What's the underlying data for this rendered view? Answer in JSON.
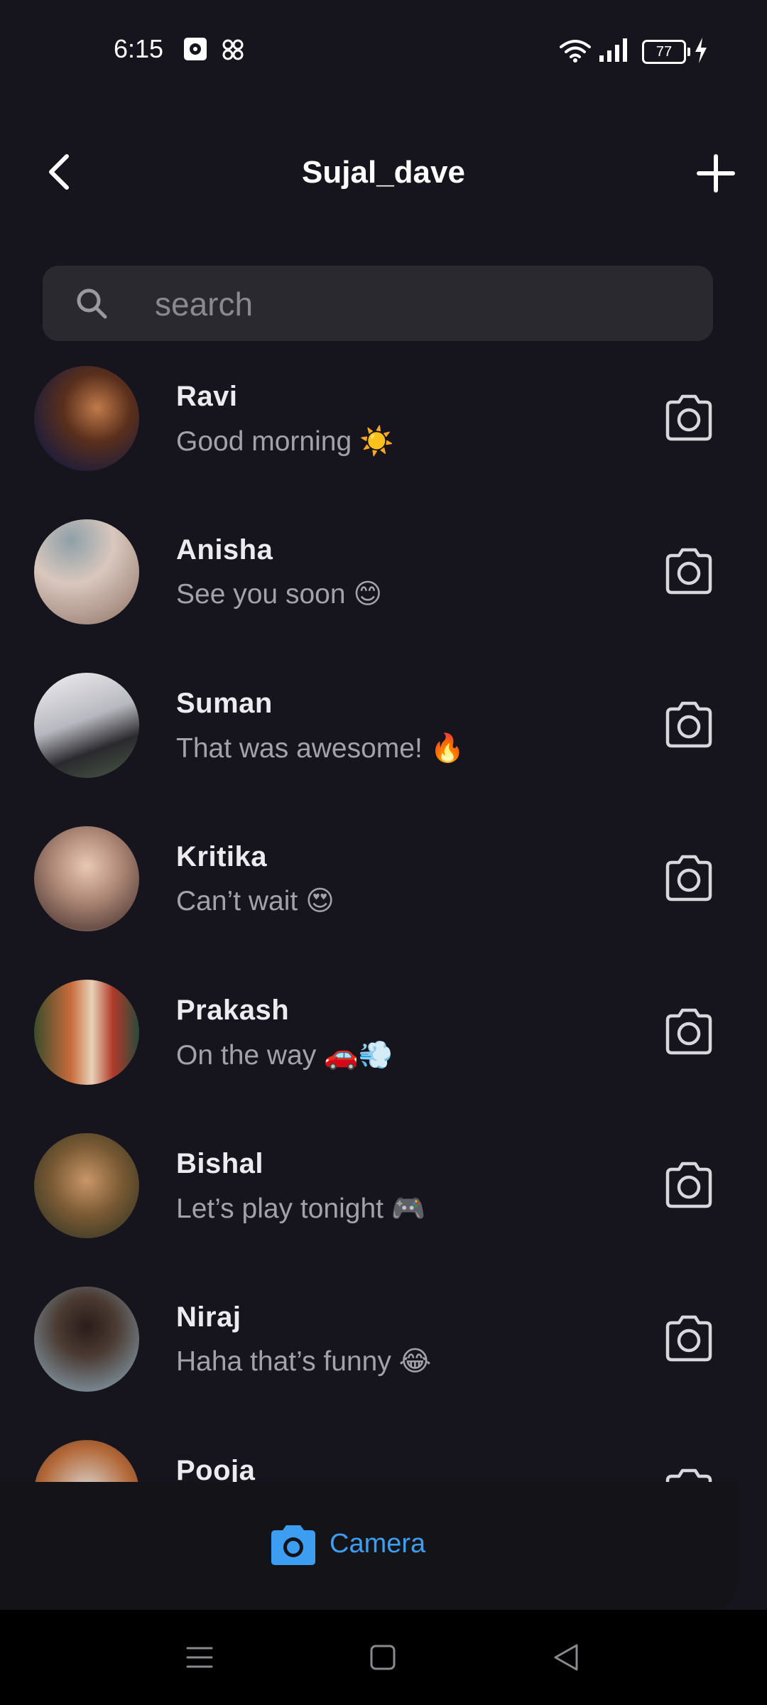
{
  "status_bar": {
    "time": "6:15",
    "battery": "77"
  },
  "header": {
    "title": "Sujal_dave"
  },
  "search": {
    "placeholder": "search"
  },
  "chats": [
    {
      "name": "Ravi",
      "message": "Good morning ☀️"
    },
    {
      "name": "Anisha",
      "message": "See you soon 😊"
    },
    {
      "name": "Suman",
      "message": "That was awesome! 🔥"
    },
    {
      "name": "Kritika",
      "message": "Can’t wait 😍"
    },
    {
      "name": "Prakash",
      "message": "On the way 🚗💨"
    },
    {
      "name": "Bishal",
      "message": "Let’s play tonight 🎮"
    },
    {
      "name": "Niraj",
      "message": "Haha that’s funny 😂"
    },
    {
      "name": "Pooja",
      "message": ""
    }
  ],
  "bottom_bar": {
    "camera_label": "Camera"
  },
  "colors": {
    "background": "#16141c",
    "search_bg": "#2a2930",
    "accent": "#3d9df0",
    "secondary_text": "#a3a2aa"
  },
  "icons": {
    "back": "chevron-left-icon",
    "add": "plus-icon",
    "search": "search-icon",
    "row_action": "camera-icon",
    "nav": [
      "menu-icon",
      "home-square-icon",
      "back-triangle-icon"
    ]
  }
}
